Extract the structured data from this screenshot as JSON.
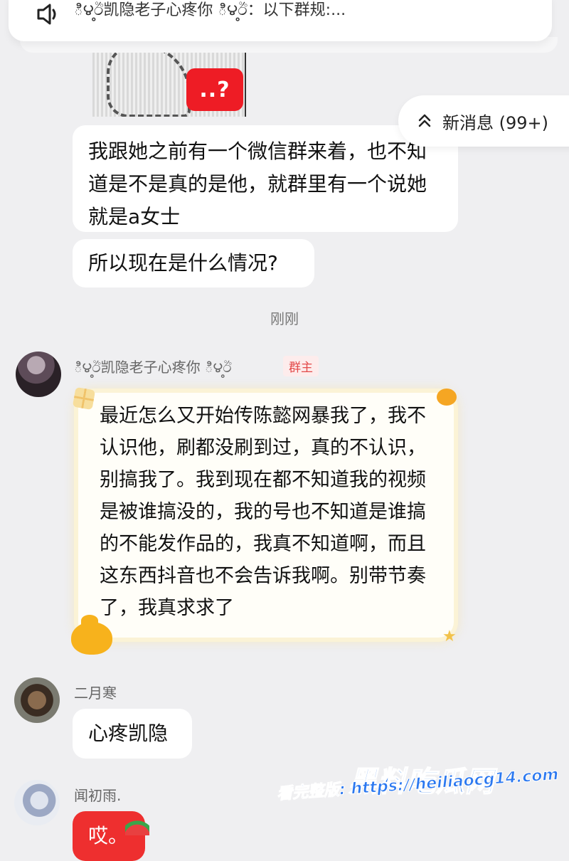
{
  "announcement": {
    "text": "ి౪఼ඊ凯隐老子心疼你 ి౪఼ඊ：以下群规:..."
  },
  "previous_image": {
    "badge_text": "..?"
  },
  "new_messages_pill": {
    "label": "新消息 (99+)"
  },
  "messages": [
    {
      "text": "我跟她之前有一个微信群来着，也不知道是不是真的是他，就群里有一个说她就是a女士"
    },
    {
      "text": "所以现在是什么情况?"
    }
  ],
  "timestamp": "刚刚",
  "owner_message": {
    "sender": "ి౪఼ඊ凯隐老子心疼你 ి౪఼ඊ",
    "role": "群主",
    "text": "最近怎么又开始传陈懿网暴我了，我不认识他，刷都没刷到过，真的不认识，别搞我了。我到现在都不知道我的视频是被谁搞没的，我的号也不知道是谁搞的不能发作品的，我真不知道啊，而且这东西抖音也不会告诉我啊。别带节奏了，我真求求了"
  },
  "reply1": {
    "sender": "二月寒",
    "text": "心疼凯隐"
  },
  "reply2": {
    "sender": "闻初雨.",
    "text": "哎。"
  },
  "watermark": {
    "title": "黑料吃瓜网",
    "url": "看完整版: https://heiliaocg14.com"
  }
}
